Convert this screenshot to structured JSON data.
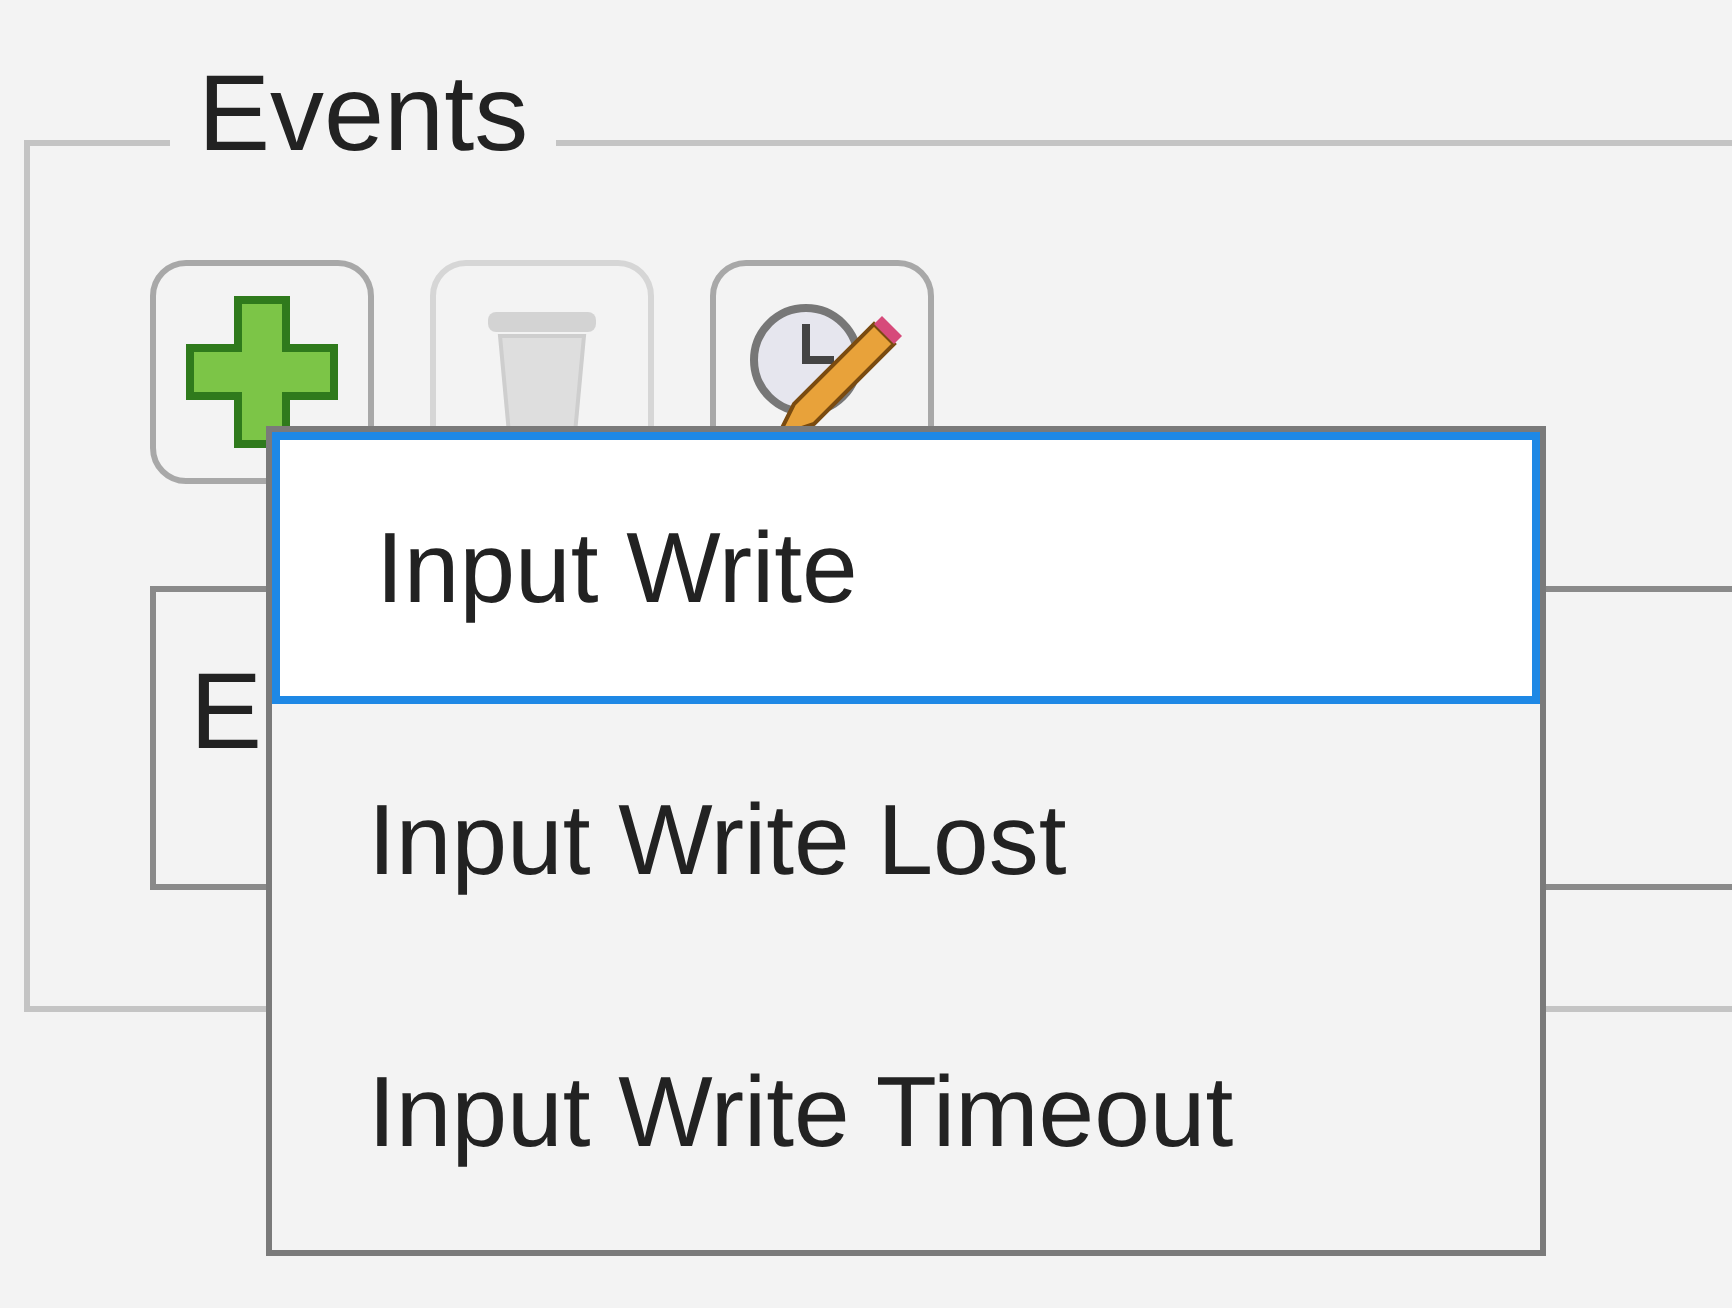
{
  "group": {
    "title": "Events"
  },
  "toolbar": [
    {
      "kind": "add",
      "disabled": false
    },
    {
      "kind": "delete",
      "disabled": true
    },
    {
      "kind": "schedule",
      "disabled": false
    }
  ],
  "list": {
    "column_1": "E"
  },
  "menu": {
    "items": [
      {
        "label": "Input Write",
        "selected": true
      },
      {
        "label": "Input Write Lost",
        "selected": false
      },
      {
        "label": "Input Write Timeout",
        "selected": false
      }
    ]
  }
}
